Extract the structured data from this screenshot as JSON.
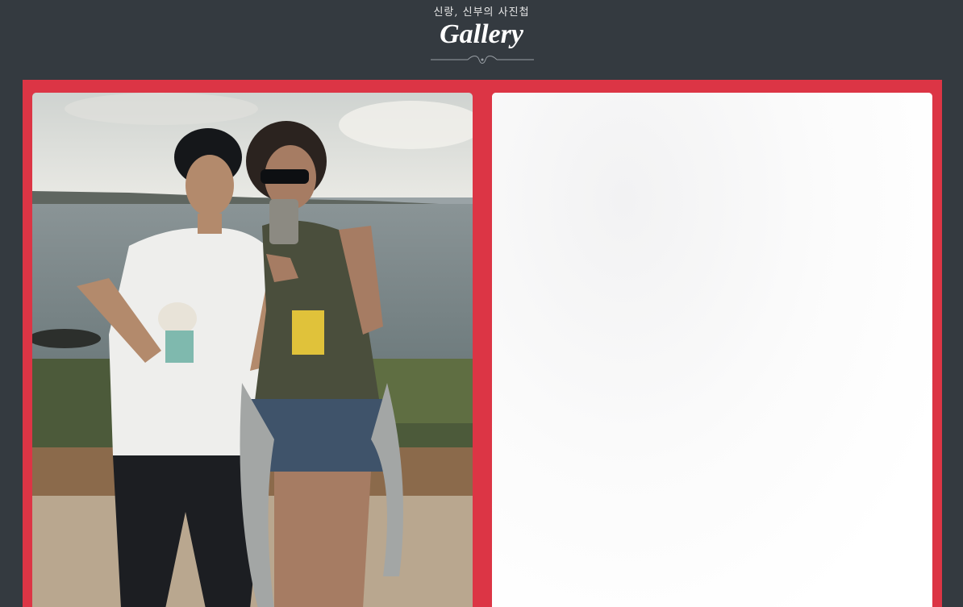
{
  "header": {
    "subtitle": "신랑, 신부의 사진첩",
    "title": "Gallery"
  },
  "gallery": {
    "accent_color": "#dc3545",
    "background_color": "#343a40",
    "photos": [
      {
        "kind": "couple-selfie-by-the-sea",
        "loaded": true
      },
      {
        "kind": "blank-light-photo",
        "loaded": false
      }
    ]
  }
}
